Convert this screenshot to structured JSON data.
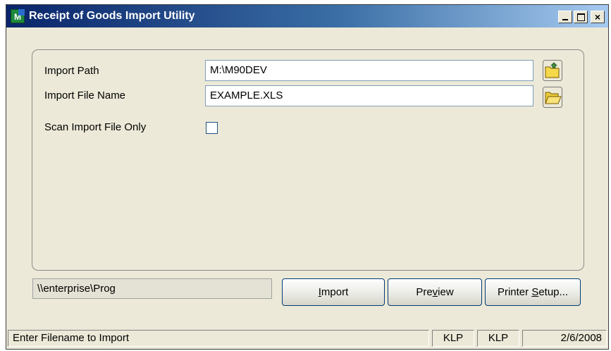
{
  "window": {
    "title": "Receipt of Goods Import Utility",
    "app_icon_letter": "M"
  },
  "titlebar_buttons": {
    "minimize": "_",
    "maximize": "□",
    "close": "×"
  },
  "form": {
    "import_path": {
      "label": "Import Path",
      "value": "M:\\M90DEV"
    },
    "import_file_name": {
      "label": "Import File Name",
      "value": "EXAMPLE.XLS"
    },
    "scan_only": {
      "label": "Scan Import File Only",
      "checked": false
    }
  },
  "bottom": {
    "server_path": "\\\\enterprise\\Prog",
    "buttons": {
      "import": {
        "pre": "",
        "key": "I",
        "post": "mport"
      },
      "preview": {
        "pre": "Pre",
        "key": "v",
        "post": "iew"
      },
      "printer_setup": {
        "pre": "Printer ",
        "key": "S",
        "post": "etup..."
      }
    }
  },
  "statusbar": {
    "message": "Enter Filename to Import",
    "user1": "KLP",
    "user2": "KLP",
    "date": "2/6/2008"
  },
  "colors": {
    "titlebar_start": "#0a246a",
    "titlebar_end": "#a6caf0",
    "window_face": "#ece9d8",
    "folder_yellow": "#f5d94a"
  },
  "icons": {
    "app": "app-icon",
    "path_browse": "folder-up-icon",
    "file_browse": "folder-open-icon"
  }
}
